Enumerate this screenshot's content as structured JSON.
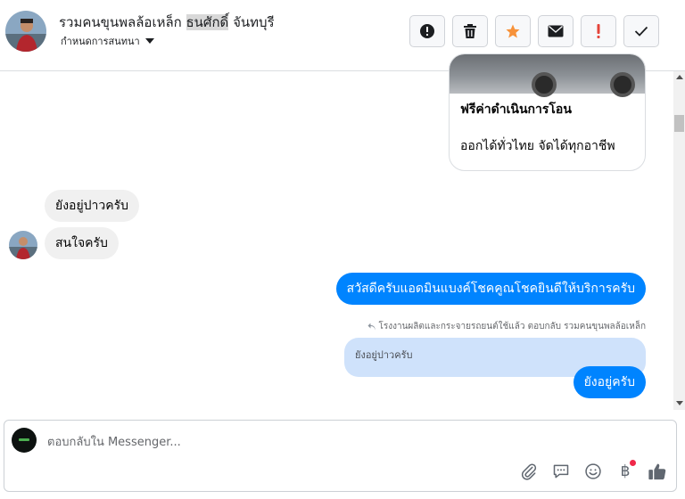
{
  "header": {
    "title_prefix": "รวมคนขุนพลล้อเหล็ก",
    "title_highlight": "ธนศักดิ์",
    "title_suffix": "จันทบุรี",
    "subtitle": "กำหนดการสนทนา",
    "toolbar": [
      {
        "name": "report-spam",
        "icon": "alert-circle-icon"
      },
      {
        "name": "delete",
        "icon": "trash-icon"
      },
      {
        "name": "star",
        "icon": "star-icon"
      },
      {
        "name": "mark-unread",
        "icon": "envelope-icon"
      },
      {
        "name": "flag-important",
        "icon": "exclamation-icon"
      },
      {
        "name": "mark-done",
        "icon": "check-icon"
      }
    ],
    "star_color": "#f7923a",
    "important_color": "#e4443a"
  },
  "card": {
    "title": "ฟรีค่าดำเนินการโอน",
    "desc": "ออกได้ทั่วไทย จัดได้ทุกอาชีพ"
  },
  "messages": {
    "incoming_1": "ยังอยู่ปาวครับ",
    "incoming_2": "สนใจครับ",
    "outgoing_1": "สวัสดีครับแอดมินแบงค์โชคคูณโชคยินดีให้บริการครับ",
    "reply_meta": "โรงงานผลิตและกระจายรถยนต์ใช้แล้ว ตอบกลับ รวมคนขุนพลล้อเหล็ก",
    "quoted": "ยังอยู่ปาวครับ",
    "outgoing_2": "ยังอยู่ครับ"
  },
  "composer": {
    "placeholder": "ตอบกลับใน Messenger...",
    "value": "",
    "currency_symbol": "฿"
  },
  "colors": {
    "accent": "#0084ff",
    "quote_bg": "#cfe2fb",
    "incoming_bg": "#f0f0f0"
  }
}
